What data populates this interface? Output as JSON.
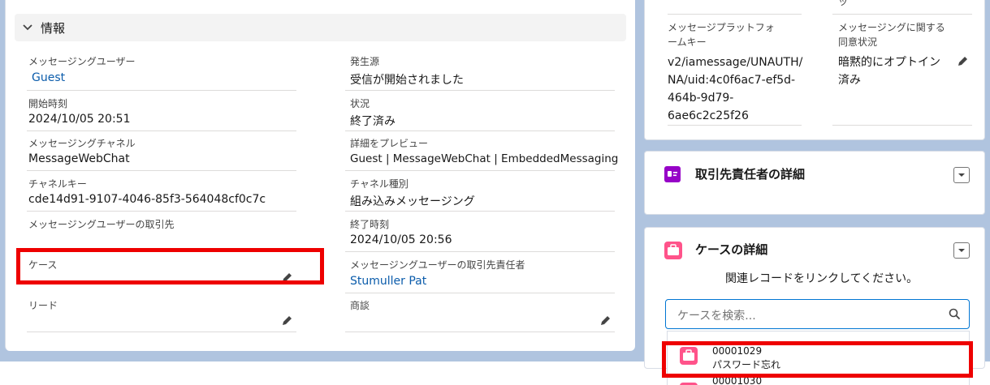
{
  "info_section": {
    "title": "情報",
    "left_fields": [
      {
        "label": "メッセージングユーザー",
        "value": "Guest"
      },
      {
        "label": "開始時刻",
        "value": "2024/10/05 20:51"
      },
      {
        "label": "メッセージングチャネル",
        "value": "MessageWebChat"
      },
      {
        "label": "チャネルキー",
        "value": "cde14d91-9107-4046-85f3-564048cf0c7c"
      },
      {
        "label": "メッセージングユーザーの取引先",
        "value": ""
      },
      {
        "label": "ケース",
        "value": ""
      },
      {
        "label": "リード",
        "value": ""
      }
    ],
    "right_fields": [
      {
        "label": "発生源",
        "value": "受信が開始されました"
      },
      {
        "label": "状況",
        "value": "終了済み"
      },
      {
        "label": "詳細をプレビュー",
        "value": "Guest | MessageWebChat | EmbeddedMessaging"
      },
      {
        "label": "チャネル種別",
        "value": "組み込みメッセージング"
      },
      {
        "label": "終了時刻",
        "value": "2024/10/05 20:56"
      },
      {
        "label": "メッセージングユーザーの取引先責任者",
        "value": "Stumuller Pat"
      },
      {
        "label": "商談",
        "value": ""
      }
    ]
  },
  "side_top": {
    "platform_key_label_l1": "メッセージプラットフォ",
    "platform_key_label_l2": "ームキー",
    "platform_key_value_l1": "v2/iamessage/UNAUTH/",
    "platform_key_value_l2": "NA/uid:4c0f6ac7-ef5d-",
    "platform_key_value_l3": "464b-9d79-",
    "platform_key_value_l4": "6ae6c2c25f26",
    "consent_label_l1": "メッセージングに関する",
    "consent_label_l2": "同意状況",
    "consent_value_l1": "暗黙的にオプトイン",
    "consent_value_l2": "済み",
    "top_partial": "ッ"
  },
  "contact_card": {
    "title": "取引先責任者の詳細",
    "icon_color": "#9602c7"
  },
  "case_card": {
    "title": "ケースの詳細",
    "icon_color": "#ff538a",
    "message": "関連レコードをリンクしてください。",
    "search_placeholder": "ケースを検索...",
    "results": [
      {
        "number": "00001029",
        "subject": "パスワード忘れ"
      },
      {
        "number": "00001030",
        "subject": ""
      }
    ]
  },
  "colors": {
    "highlight": "#ee0000",
    "link": "#0b5cab",
    "background": "#b0c4df"
  }
}
